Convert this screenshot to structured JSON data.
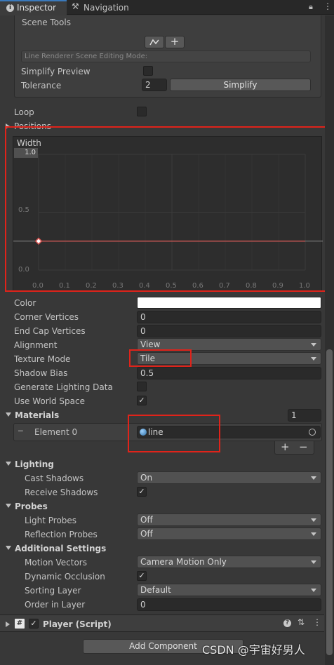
{
  "tabs": [
    {
      "label": "Inspector",
      "icon": "info-icon",
      "active": true
    },
    {
      "label": "Navigation",
      "icon": "navigation-icon",
      "active": false
    }
  ],
  "scene_tools": {
    "title": "Scene Tools",
    "mode_placeholder": "Line Renderer Scene Editing Mode:",
    "simplify_preview_label": "Simplify Preview",
    "simplify_preview_checked": false,
    "tolerance_label": "Tolerance",
    "tolerance_value": "2",
    "simplify_button": "Simplify"
  },
  "loop_label": "Loop",
  "loop_checked": false,
  "positions_label": "Positions",
  "width_curve": {
    "title": "Width",
    "top_value": "1.0",
    "y_ticks": [
      "0.5",
      "0.0"
    ],
    "x_ticks": [
      "0.0",
      "0.1",
      "0.2",
      "0.3",
      "0.4",
      "0.5",
      "0.6",
      "0.7",
      "0.8",
      "0.9",
      "1.0"
    ],
    "key_value": 0.25,
    "curve_color": "#d9534f"
  },
  "properties": {
    "color_label": "Color",
    "color_value": "#ffffff",
    "corner_vertices_label": "Corner Vertices",
    "corner_vertices_value": "0",
    "end_cap_vertices_label": "End Cap Vertices",
    "end_cap_vertices_value": "0",
    "alignment_label": "Alignment",
    "alignment_value": "View",
    "texture_mode_label": "Texture Mode",
    "texture_mode_value": "Tile",
    "shadow_bias_label": "Shadow Bias",
    "shadow_bias_value": "0.5",
    "generate_lighting_label": "Generate Lighting Data",
    "generate_lighting_checked": false,
    "use_world_space_label": "Use World Space",
    "use_world_space_checked": true
  },
  "materials": {
    "title": "Materials",
    "count": "1",
    "element_label": "Element 0",
    "element_value": "line",
    "add_label": "+",
    "remove_label": "−"
  },
  "lighting": {
    "title": "Lighting",
    "cast_shadows_label": "Cast Shadows",
    "cast_shadows_value": "On",
    "receive_shadows_label": "Receive Shadows",
    "receive_shadows_checked": true
  },
  "probes": {
    "title": "Probes",
    "light_probes_label": "Light Probes",
    "light_probes_value": "Off",
    "reflection_probes_label": "Reflection Probes",
    "reflection_probes_value": "Off"
  },
  "additional": {
    "title": "Additional Settings",
    "motion_vectors_label": "Motion Vectors",
    "motion_vectors_value": "Camera Motion Only",
    "dynamic_occlusion_label": "Dynamic Occlusion",
    "dynamic_occlusion_checked": true,
    "sorting_layer_label": "Sorting Layer",
    "sorting_layer_value": "Default",
    "order_in_layer_label": "Order in Layer",
    "order_in_layer_value": "0"
  },
  "player_script": {
    "title": "Player (Script)",
    "enabled": true
  },
  "add_component": "Add Component",
  "watermark": "CSDN @宇宙好男人",
  "check_glyph": "✓"
}
